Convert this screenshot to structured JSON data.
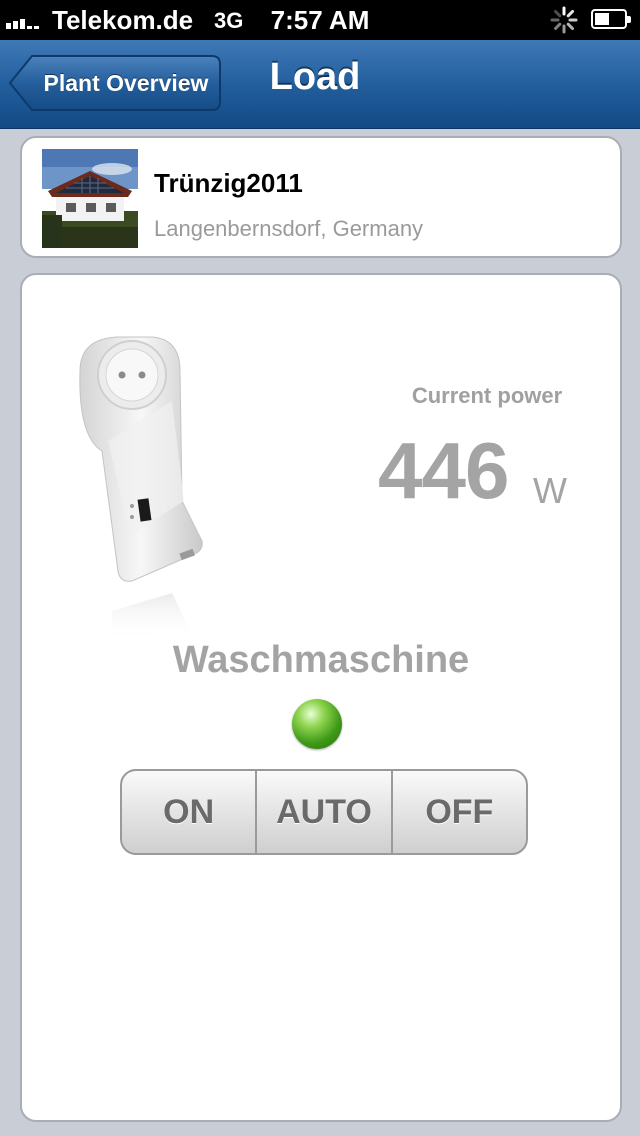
{
  "status_bar": {
    "carrier": "Telekom.de",
    "network": "3G",
    "time": "7:57 AM"
  },
  "nav": {
    "back_label": "Plant Overview",
    "title": "Load"
  },
  "plant": {
    "name": "Trünzig2011",
    "location": "Langenbernsdorf, Germany"
  },
  "load": {
    "power_label": "Current power",
    "power_value": "446",
    "power_unit": "W",
    "device_name": "Waschmaschine",
    "status_color": "#3f9a18",
    "modes": [
      "ON",
      "AUTO",
      "OFF"
    ]
  },
  "colors": {
    "nav_blue": "#235e9e",
    "background": "#c8cdd6"
  }
}
